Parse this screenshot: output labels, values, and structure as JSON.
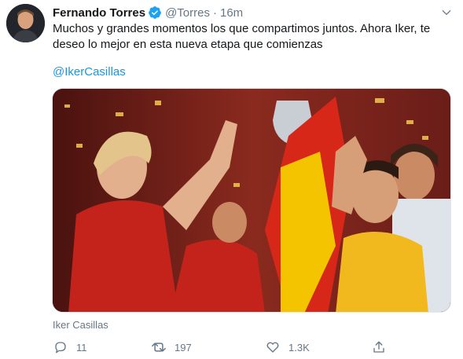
{
  "tweet": {
    "author_name": "Fernando Torres",
    "handle": "@Torres",
    "separator": "·",
    "time": "16m",
    "text": "Muchos y grandes momentos los que compartimos juntos. Ahora Iker, te deseo lo mejor en esta nueva etapa que comienzas",
    "mention": "@IkerCasillas",
    "media_tag": "Iker Casillas",
    "reply_count": "11",
    "retweet_count": "197",
    "like_count": "1.3K"
  },
  "icons": {
    "verified": "verified-badge-icon",
    "caret": "chevron-down-icon",
    "reply": "reply-icon",
    "retweet": "retweet-icon",
    "like": "heart-icon",
    "share": "share-icon"
  },
  "colors": {
    "link": "#1b95e0",
    "secondary_text": "#657786",
    "verified": "#1da1f2"
  }
}
